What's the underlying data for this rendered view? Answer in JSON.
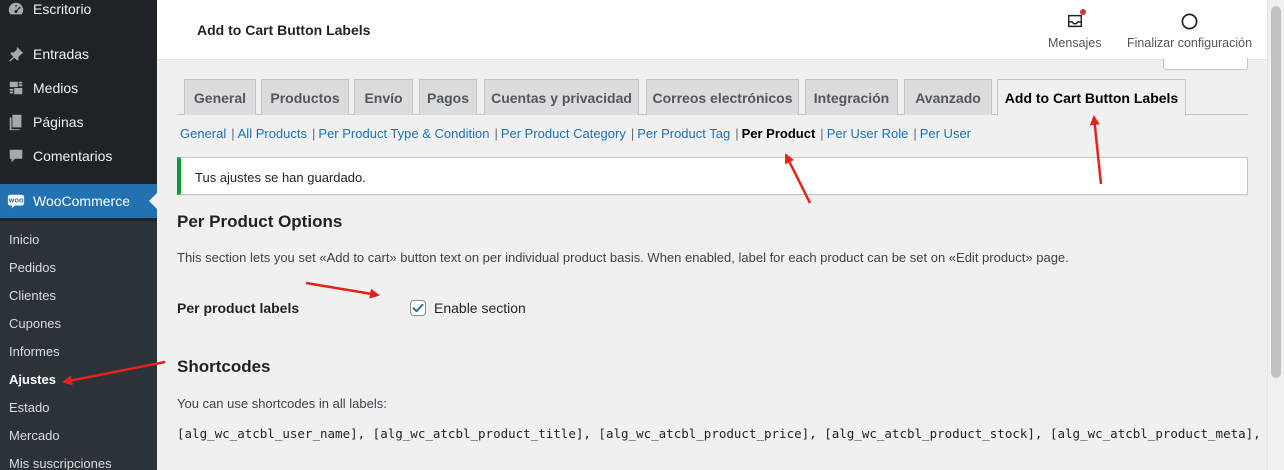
{
  "sidebar": {
    "menu": [
      {
        "label": "Escritorio",
        "icon": "dashboard-icon"
      },
      {
        "label": "Entradas",
        "icon": "pin-icon"
      },
      {
        "label": "Medios",
        "icon": "media-icon"
      },
      {
        "label": "Páginas",
        "icon": "pages-icon"
      },
      {
        "label": "Comentarios",
        "icon": "comments-icon"
      },
      {
        "label": "WooCommerce",
        "icon": "woocommerce-icon"
      }
    ],
    "submenu": [
      "Inicio",
      "Pedidos",
      "Clientes",
      "Cupones",
      "Informes",
      "Ajustes",
      "Estado",
      "Mercado",
      "Mis suscripciones"
    ],
    "active_submenu": "Ajustes",
    "woo_badge": "Woo"
  },
  "header": {
    "title": "Add to Cart Button Labels",
    "actions": [
      {
        "label": "Mensajes",
        "icon": "inbox-icon"
      },
      {
        "label": "Finalizar configuración",
        "icon": "circle-progress-icon"
      }
    ]
  },
  "tabs": [
    "General",
    "Productos",
    "Envío",
    "Pagos",
    "Cuentas y privacidad",
    "Correos electrónicos",
    "Integración",
    "Avanzado",
    "Add to Cart Button Labels"
  ],
  "active_tab": "Add to Cart Button Labels",
  "subsections": [
    "General",
    "All Products",
    "Per Product Type & Condition",
    "Per Product Category",
    "Per Product Tag",
    "Per Product",
    "Per User Role",
    "Per User"
  ],
  "active_subsection": "Per Product",
  "notice": {
    "text": "Tus ajustes se han guardado.",
    "color": "#00a32a"
  },
  "options": {
    "title": "Per Product Options",
    "description": "This section lets you set «Add to cart» button text on per individual product basis. When enabled, label for each product can be set on «Edit product» page.",
    "field_label": "Per product labels",
    "checkbox_label": "Enable section",
    "checked": true
  },
  "shortcodes": {
    "title": "Shortcodes",
    "description": "You can use shortcodes in all labels:",
    "list": "[alg_wc_atcbl_user_name], [alg_wc_atcbl_product_title], [alg_wc_atcbl_product_price], [alg_wc_atcbl_product_stock], [alg_wc_atcbl_product_meta], [alg_wc_"
  },
  "colors": {
    "sidebar_bg": "#1d2327",
    "accent": "#2271b1",
    "annotation_arrow": "#e2231a"
  }
}
